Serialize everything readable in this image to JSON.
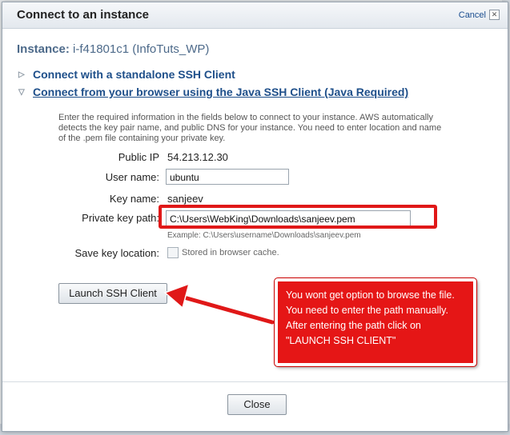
{
  "dialog": {
    "title": "Connect to an instance",
    "cancel_label": "Cancel",
    "instance_label": "Instance:",
    "instance_id": "i-f41801c1 (InfoTuts_WP)"
  },
  "options": {
    "standalone": "Connect with a standalone SSH Client",
    "browser": "Connect from your browser using the Java SSH Client (Java Required)"
  },
  "form": {
    "description": "Enter the required information in the fields below to connect to your instance. AWS automatically detects the key pair name, and public DNS for your instance. You need to enter location and name of the .pem file containing your private key.",
    "public_ip_label": "Public IP",
    "public_ip_value": "54.213.12.30",
    "user_name_label": "User name:",
    "user_name_value": "ubuntu",
    "key_name_label": "Key name:",
    "key_name_value": "sanjeev",
    "private_key_label": "Private key path:",
    "private_key_value": "C:\\Users\\WebKing\\Downloads\\sanjeev.pem",
    "private_key_example": "Example: C:\\Users\\username\\Downloads\\sanjeev.pem",
    "save_key_label": "Save key location:",
    "save_key_checkbox_label": "Stored in browser cache."
  },
  "buttons": {
    "launch": "Launch SSH Client",
    "close": "Close"
  },
  "annotation": {
    "text": "You wont get option to browse the file. You need to enter the path manually. After entering the path click on \"LAUNCH SSH CLIENT\""
  }
}
